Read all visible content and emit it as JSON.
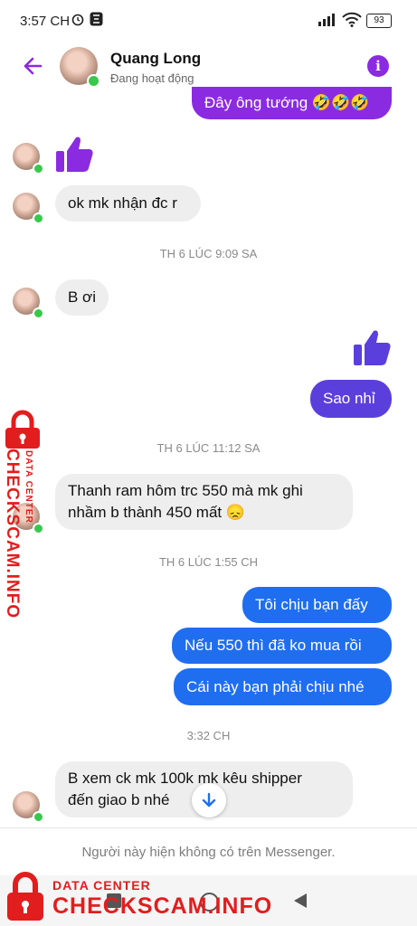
{
  "status_bar": {
    "time": "3:57 CH",
    "battery": "93"
  },
  "header": {
    "name": "Quang Long",
    "status": "Đang hoạt động"
  },
  "messages": {
    "m1": "Đây ông tướng 🤣🤣🤣",
    "m2": "ok mk nhận đc r",
    "ts1": "TH 6 LÚC 9:09 SA",
    "m3": "B ơi",
    "m4": "Sao nhỉ",
    "ts2": "TH 6 LÚC 11:12 SA",
    "m5_line1": "Thanh ram hôm trc 550 mà mk ghi",
    "m5_line2": "nhầm b thành 450 mất 😞",
    "ts3": "TH 6 LÚC 1:55 CH",
    "m6": "Tôi chịu bạn đấy",
    "m7": "Nếu 550 thì đã ko mua rồi",
    "m8": "Cái này bạn phải chịu nhé",
    "ts4": "3:32 CH",
    "m9_line1": "B xem ck mk 100k mk kêu shipper",
    "m9_line2": "đến giao b nhé"
  },
  "footer": {
    "notice": "Người này hiện không có trên Messenger."
  },
  "watermark": {
    "line1": "DATA CENTER",
    "line2": "CHECKSCAM.INFO"
  },
  "colors": {
    "purple": "#8a2be2",
    "indigo": "#5b3fdc",
    "blue": "#1f6ef0",
    "watermark": "#e21d1d"
  }
}
